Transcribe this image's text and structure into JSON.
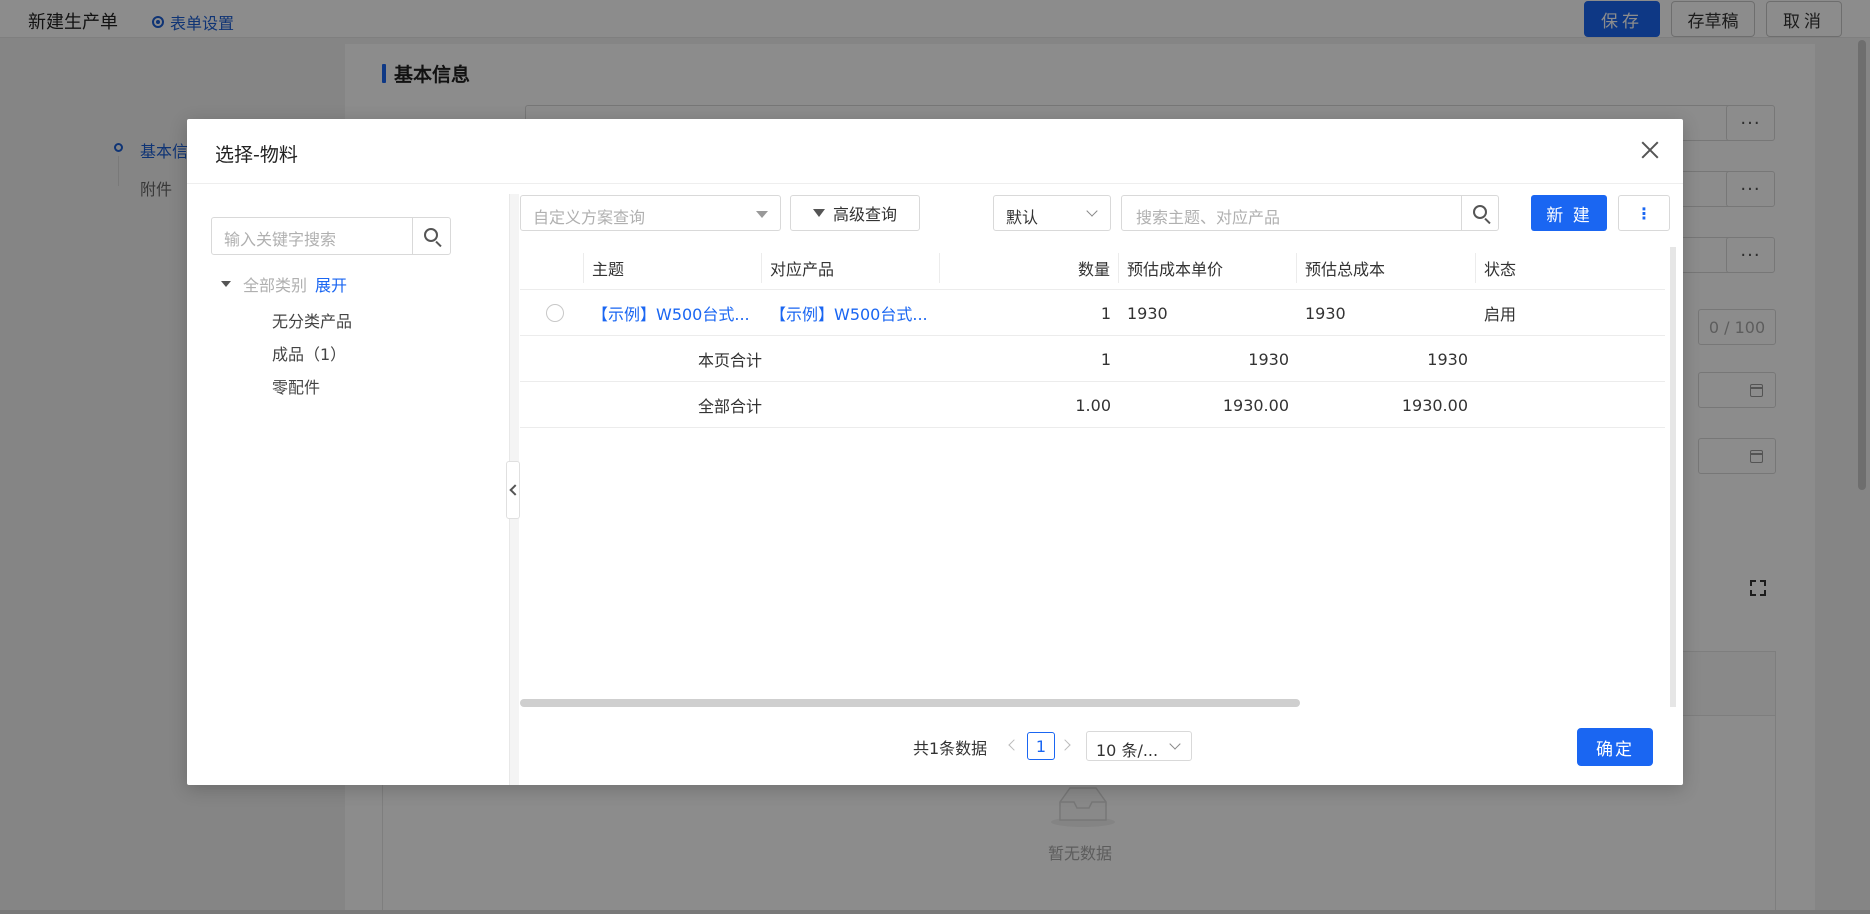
{
  "page": {
    "title": "新建生产单",
    "form_settings": "表单设置",
    "buttons": {
      "save": "保存",
      "draft": "存草稿",
      "cancel": "取消"
    },
    "side_nav": [
      "基本信息",
      "附件"
    ],
    "section_title": "基本信息",
    "counter": "0 / 100",
    "empty_text": "暂无数据",
    "more_label": "···"
  },
  "modal": {
    "title": "选择-物料",
    "tree": {
      "search_placeholder": "输入关键字搜索",
      "root_label": "全部类别",
      "expand_label": "展开",
      "nodes": [
        "无分类产品",
        "成品（1）",
        "零配件"
      ]
    },
    "toolbar": {
      "scheme_placeholder": "自定义方案查询",
      "advanced_query": "高级查询",
      "sort_value": "默认",
      "search_placeholder": "搜索主题、对应产品",
      "new_button": "新 建",
      "more_button": "⋮"
    },
    "table": {
      "columns": [
        "主题",
        "对应产品",
        "数量",
        "预估成本单价",
        "预估总成本",
        "状态"
      ],
      "rows": [
        {
          "subject": "【示例】W500台式...",
          "product": "【示例】W500台式...",
          "qty": "1",
          "unit_cost": "1930",
          "total_cost": "1930",
          "status": "启用"
        }
      ],
      "page_total": {
        "label": "本页合计",
        "qty": "1",
        "unit_cost": "1930",
        "total_cost": "1930"
      },
      "all_total": {
        "label": "全部合计",
        "qty": "1.00",
        "unit_cost": "1930.00",
        "total_cost": "1930.00"
      }
    },
    "pagination": {
      "total_text": "共1条数据",
      "current_page": "1",
      "page_size": "10 条/..."
    },
    "confirm_button": "确定"
  },
  "colors": {
    "primary": "#1a66f2",
    "link": "#1d5fd6"
  }
}
